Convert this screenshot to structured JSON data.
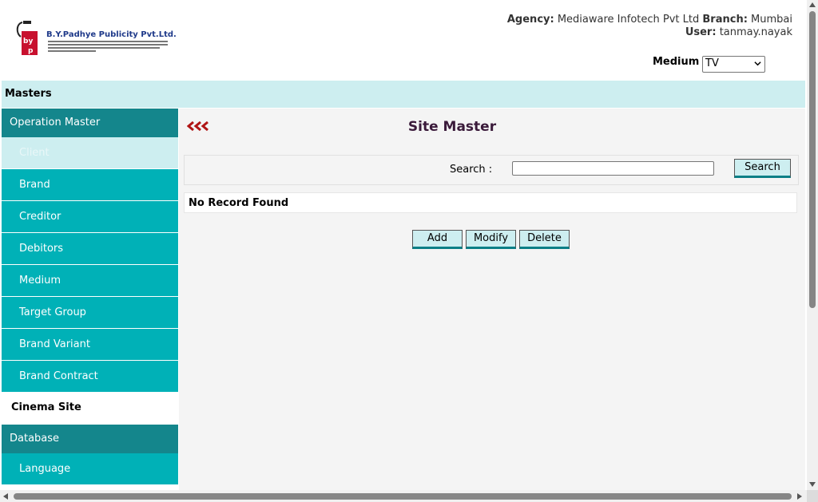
{
  "header": {
    "logo_text": "B.Y.Padhye Publicity Pvt.Ltd.",
    "agency_label": "Agency:",
    "agency_value": "Mediaware Infotech Pvt Ltd",
    "branch_label": "Branch:",
    "branch_value": "Mumbai",
    "user_label": "User:",
    "user_value": "tanmay.nayak",
    "medium_label": "Medium",
    "medium_selected": "TV"
  },
  "masters_bar": {
    "label": "Masters"
  },
  "sidebar": {
    "items": [
      {
        "label": "Operation Master",
        "kind": "head"
      },
      {
        "label": "Client",
        "kind": "sub-active"
      },
      {
        "label": "Brand",
        "kind": "sub"
      },
      {
        "label": "Creditor",
        "kind": "sub"
      },
      {
        "label": "Debitors",
        "kind": "sub"
      },
      {
        "label": "Medium",
        "kind": "sub"
      },
      {
        "label": "Target Group",
        "kind": "sub"
      },
      {
        "label": "Brand Variant",
        "kind": "sub"
      },
      {
        "label": "Brand Contract",
        "kind": "sub"
      },
      {
        "label": "Cinema Site",
        "kind": "plain"
      },
      {
        "label": "Database",
        "kind": "head"
      },
      {
        "label": "Language",
        "kind": "sub"
      }
    ]
  },
  "content": {
    "title": "Site Master",
    "search_label": "Search :",
    "search_value": "",
    "search_button": "Search",
    "no_record": "No Record Found",
    "buttons": {
      "add": "Add",
      "modify": "Modify",
      "delete": "Delete"
    }
  },
  "colors": {
    "header_bar": "#cdeef0",
    "sidebar_head": "#14868c",
    "sidebar_sub": "#00b1b7",
    "back_icon": "#b01515",
    "title": "#3a1a3a"
  },
  "icons": {
    "back": "back-arrows-icon",
    "dropdown": "chevron-down-icon",
    "logo": "company-logo-icon"
  }
}
